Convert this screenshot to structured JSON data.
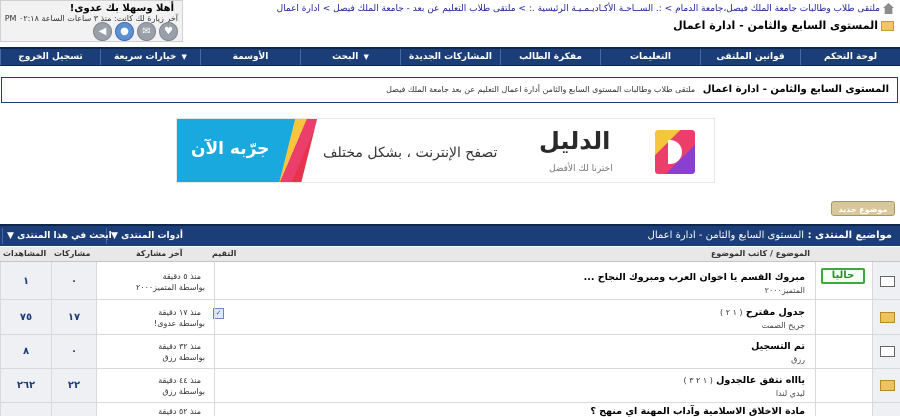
{
  "header": {
    "welcome": "أهلا وسهلا بك عدوى!",
    "last_visit": "آخر زيارة لك كانت: منذ ٣ ساعات الساعة ٠٢:١٨ PM",
    "breadcrumb": "ملتقى طلاب وطالبات جامعة الملك فيصل،جامعة الدمام > :. الســاحـة الأكـاديـمـيـة الرئيسية .: > ملتقى طلاب التعليم عن بعد - جامعة الملك فيصل > ادارة اعمال",
    "current_page": "المستوى السابع والثامن - ادارة اعمال"
  },
  "navbar": {
    "items": [
      {
        "label": "لوحة التحكم"
      },
      {
        "label": "قوانين الملتقى"
      },
      {
        "label": "التعليمات"
      },
      {
        "label": "مفكرة الطالب"
      },
      {
        "label": "المشاركات الجديدة"
      },
      {
        "label": "البحث",
        "dropdown": true
      },
      {
        "label": "الأوسمة"
      },
      {
        "label": "خيارات سريعة",
        "dropdown": true
      },
      {
        "label": "تسجيل الخروج"
      }
    ]
  },
  "forum": {
    "title": "المستوى السابع والثامن - ادارة اعمال",
    "description": "ملتقى طلاب وطالبات المستوى السابع والثامن أدارة اعمال التعليم عن بعد جامعة الملك فيصل"
  },
  "ad": {
    "cta": "جرّبه الآن",
    "tagline": "تصفح الإنترنت ، بشكل مختلف",
    "brand": "الدليل",
    "sub": "اخترنا لك الأفضل"
  },
  "new_thread_label": "موضوع جديد",
  "threads_header": {
    "label": "مواضيع المنتدى :",
    "forum_name": "المستوى السابع والثامن - ادارة اعمال",
    "tools_label": "أدوات المنتدى",
    "search_label": "ابحث في هذا المنتدى"
  },
  "columns": {
    "topic": "الموضوع / كاتب الموضوع",
    "rating": "التقيم",
    "last_post": "آخر مشاركة",
    "replies": "مشاركات",
    "views": "المشاهدات"
  },
  "threads": [
    {
      "title": "مبروك القسم يا اخوان العرب ومبروك النجاح ...",
      "author": "المتميز٢٠٠٠",
      "pages": "",
      "last_time": "منذ ٥ دقيقة",
      "last_by": "بواسطة المتميز٢٠٠٠",
      "replies": "٠",
      "views": "١",
      "badge": "حاليا",
      "rated": false
    },
    {
      "title": "جدول مقترح",
      "author": "جريح الصمت",
      "pages": "( ١ ٢ )",
      "last_time": "منذ ١٧ دقيقة",
      "last_by": "بواسطة عدوى!",
      "replies": "١٧",
      "views": "٧٥",
      "badge": "",
      "rated": true
    },
    {
      "title": "تم التسجيل",
      "author": "رزق",
      "pages": "",
      "last_time": "منذ ٣٢ دقيقة",
      "last_by": "بواسطة رزق",
      "replies": "٠",
      "views": "٨",
      "badge": "",
      "rated": false
    },
    {
      "title": "ياااه نتفق عالجدول",
      "author": "ليدي لندا",
      "pages": "( ١ ٢ ٣ )",
      "last_time": "منذ ٤٤ دقيقة",
      "last_by": "بواسطة رزق",
      "replies": "٢٢",
      "views": "٢٦٢",
      "badge": "",
      "rated": false
    },
    {
      "title": "مادة الاخلاق الاسلامية وآداب المهنة اي منهج ؟",
      "author": "",
      "pages": "",
      "last_time": "منذ ٥٢ دقيقة",
      "last_by": "",
      "replies": "",
      "views": "",
      "badge": "",
      "rated": false
    }
  ]
}
